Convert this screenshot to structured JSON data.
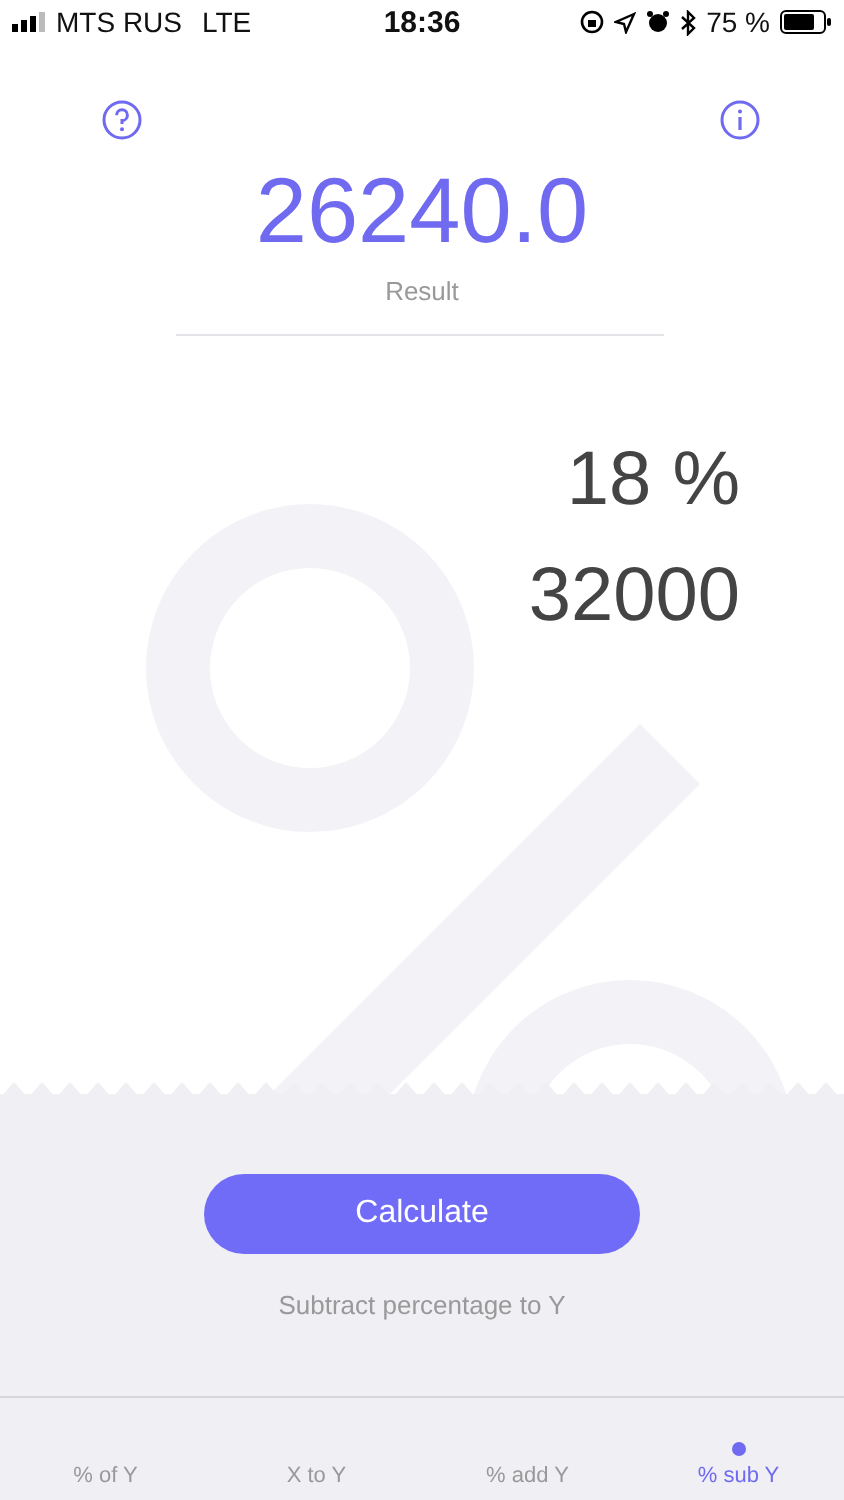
{
  "status_bar": {
    "carrier": "MTS RUS",
    "network": "LTE",
    "time": "18:36",
    "battery": "75 %"
  },
  "result": {
    "value": "26240.0",
    "label": "Result"
  },
  "inputs": [
    {
      "value": "18 %"
    },
    {
      "value": "32000"
    }
  ],
  "calculate_button": "Calculate",
  "description": "Subtract percentage to Y",
  "tabs": [
    {
      "label": "% of Y",
      "selected": false
    },
    {
      "label": "X to Y",
      "selected": false
    },
    {
      "label": "% add Y",
      "selected": false
    },
    {
      "label": "% sub Y",
      "selected": true
    }
  ]
}
